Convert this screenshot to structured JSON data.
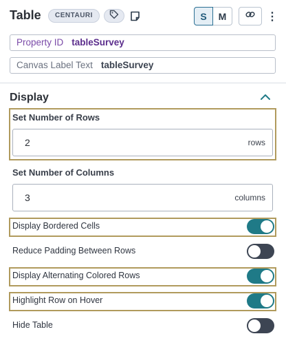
{
  "header": {
    "title": "Table",
    "badge": "CENTAURI",
    "size_options": [
      "S",
      "M"
    ],
    "active_size": "S",
    "more_glyph": "⋮",
    "icons": [
      "tag-icon",
      "note-icon",
      "link-icon",
      "more-vertical-icon"
    ]
  },
  "properties": {
    "property_id_label": "Property ID",
    "property_id_value": "tableSurvey",
    "canvas_label_label": "Canvas Label Text",
    "canvas_label_value": "tableSurvey"
  },
  "display": {
    "title": "Display",
    "rows": {
      "label": "Set Number of Rows",
      "value": "2",
      "unit": "rows"
    },
    "columns": {
      "label": "Set Number of Columns",
      "value": "3",
      "unit": "columns"
    },
    "toggles": [
      {
        "label": "Display Bordered Cells",
        "on": true
      },
      {
        "label": "Reduce Padding Between Rows",
        "on": false
      },
      {
        "label": "Display Alternating Colored Rows",
        "on": true
      },
      {
        "label": "Highlight Row on Hover",
        "on": true
      },
      {
        "label": "Hide Table",
        "on": false
      }
    ]
  },
  "colors": {
    "accent_teal": "#1f7a87",
    "toggle_off": "#3d4553",
    "highlight_border": "#b09a5c",
    "property_id_purple": "#5b2d8c"
  }
}
